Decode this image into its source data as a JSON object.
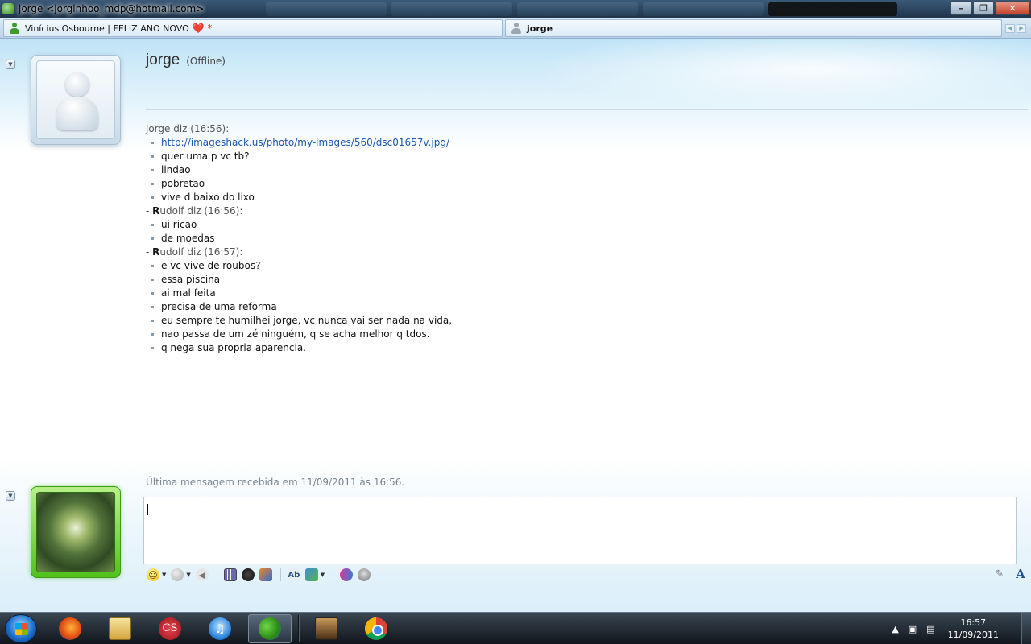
{
  "window": {
    "title": "jorge <jorginhoo_mdp@hotmail.com>",
    "controls": {
      "minimize": "–",
      "maximize": "❐",
      "close": "✕"
    }
  },
  "tabs": [
    {
      "label": "Vinícius Osbourne | FELIZ ANO NOVO",
      "suffix": "❤️ *",
      "status_color": "#3e9c2c"
    },
    {
      "label": "jorge",
      "status_color": "#9aa6b2"
    }
  ],
  "tab_scroll": {
    "prev": "◀",
    "next": "▶"
  },
  "expander_glyph": "▼",
  "contact": {
    "name": "jorge",
    "status": "(Offline)"
  },
  "messages": [
    {
      "type": "sender",
      "prefix": "",
      "initial": "",
      "name": "jorge diz (16:56):"
    },
    {
      "type": "link",
      "text": "http://imageshack.us/photo/my-images/560/dsc01657v.jpg/"
    },
    {
      "type": "item",
      "text": "quer uma p vc tb?"
    },
    {
      "type": "item",
      "text": "lindao"
    },
    {
      "type": "item",
      "text": "pobretao"
    },
    {
      "type": "item",
      "text": "vive d baixo do lixo"
    },
    {
      "type": "sender",
      "prefix": "- ",
      "initial": "R",
      "name": "udolf diz (16:56):"
    },
    {
      "type": "item",
      "text": "ui ricao"
    },
    {
      "type": "item",
      "text": "de moedas"
    },
    {
      "type": "sender",
      "prefix": "- ",
      "initial": "R",
      "name": "udolf diz (16:57):"
    },
    {
      "type": "item",
      "text": "e vc vive de roubos?"
    },
    {
      "type": "item",
      "text": "essa piscina"
    },
    {
      "type": "item",
      "text": "ai mal feita"
    },
    {
      "type": "item",
      "text": "precisa de uma reforma"
    },
    {
      "type": "item",
      "text": "eu sempre te humilhei jorge, vc nunca vai ser nada na vida,"
    },
    {
      "type": "item",
      "text": "nao passa de um zé ninguém, q se acha melhor q tdos."
    },
    {
      "type": "item",
      "text": "q nega sua propria aparencia."
    }
  ],
  "last_message": "Última mensagem recebida em 11/09/2011 às 16:56.",
  "compose": {
    "value": "",
    "placeholder": ""
  },
  "toolbar": {
    "buttons": [
      {
        "name": "emoticon-icon",
        "glyph": "☺",
        "dropdown": true
      },
      {
        "name": "wink-icon",
        "glyph": "",
        "dropdown": true
      },
      {
        "name": "nudge-icon",
        "glyph": "◀",
        "dropdown": false
      },
      {
        "sep": true
      },
      {
        "name": "activities-icon",
        "glyph": "",
        "dropdown": false
      },
      {
        "name": "voice-clip-icon",
        "glyph": "",
        "dropdown": false
      },
      {
        "name": "games-icon",
        "glyph": "",
        "dropdown": false
      },
      {
        "sep": true
      },
      {
        "name": "spellcheck-icon",
        "glyph": "Aƀ",
        "dropdown": false
      },
      {
        "name": "share-photos-icon",
        "glyph": "",
        "dropdown": true
      },
      {
        "sep": true
      },
      {
        "name": "invite-contact-icon",
        "glyph": "",
        "dropdown": false
      },
      {
        "name": "block-contact-icon",
        "glyph": "",
        "dropdown": false
      }
    ],
    "pen_glyph": "✎",
    "font_glyph": "A"
  },
  "taskbar": {
    "apps": [
      "firefox-icon",
      "file-explorer-icon",
      "creative-suite-icon",
      "itunes-icon",
      "messenger-icon",
      "game-icon",
      "chrome-icon"
    ],
    "cs_label": "CS",
    "itunes_glyph": "♫",
    "tray": {
      "show_hidden": "▲",
      "network": "▣",
      "power": "▤"
    },
    "clock": {
      "time": "16:57",
      "date": "11/09/2011"
    }
  }
}
